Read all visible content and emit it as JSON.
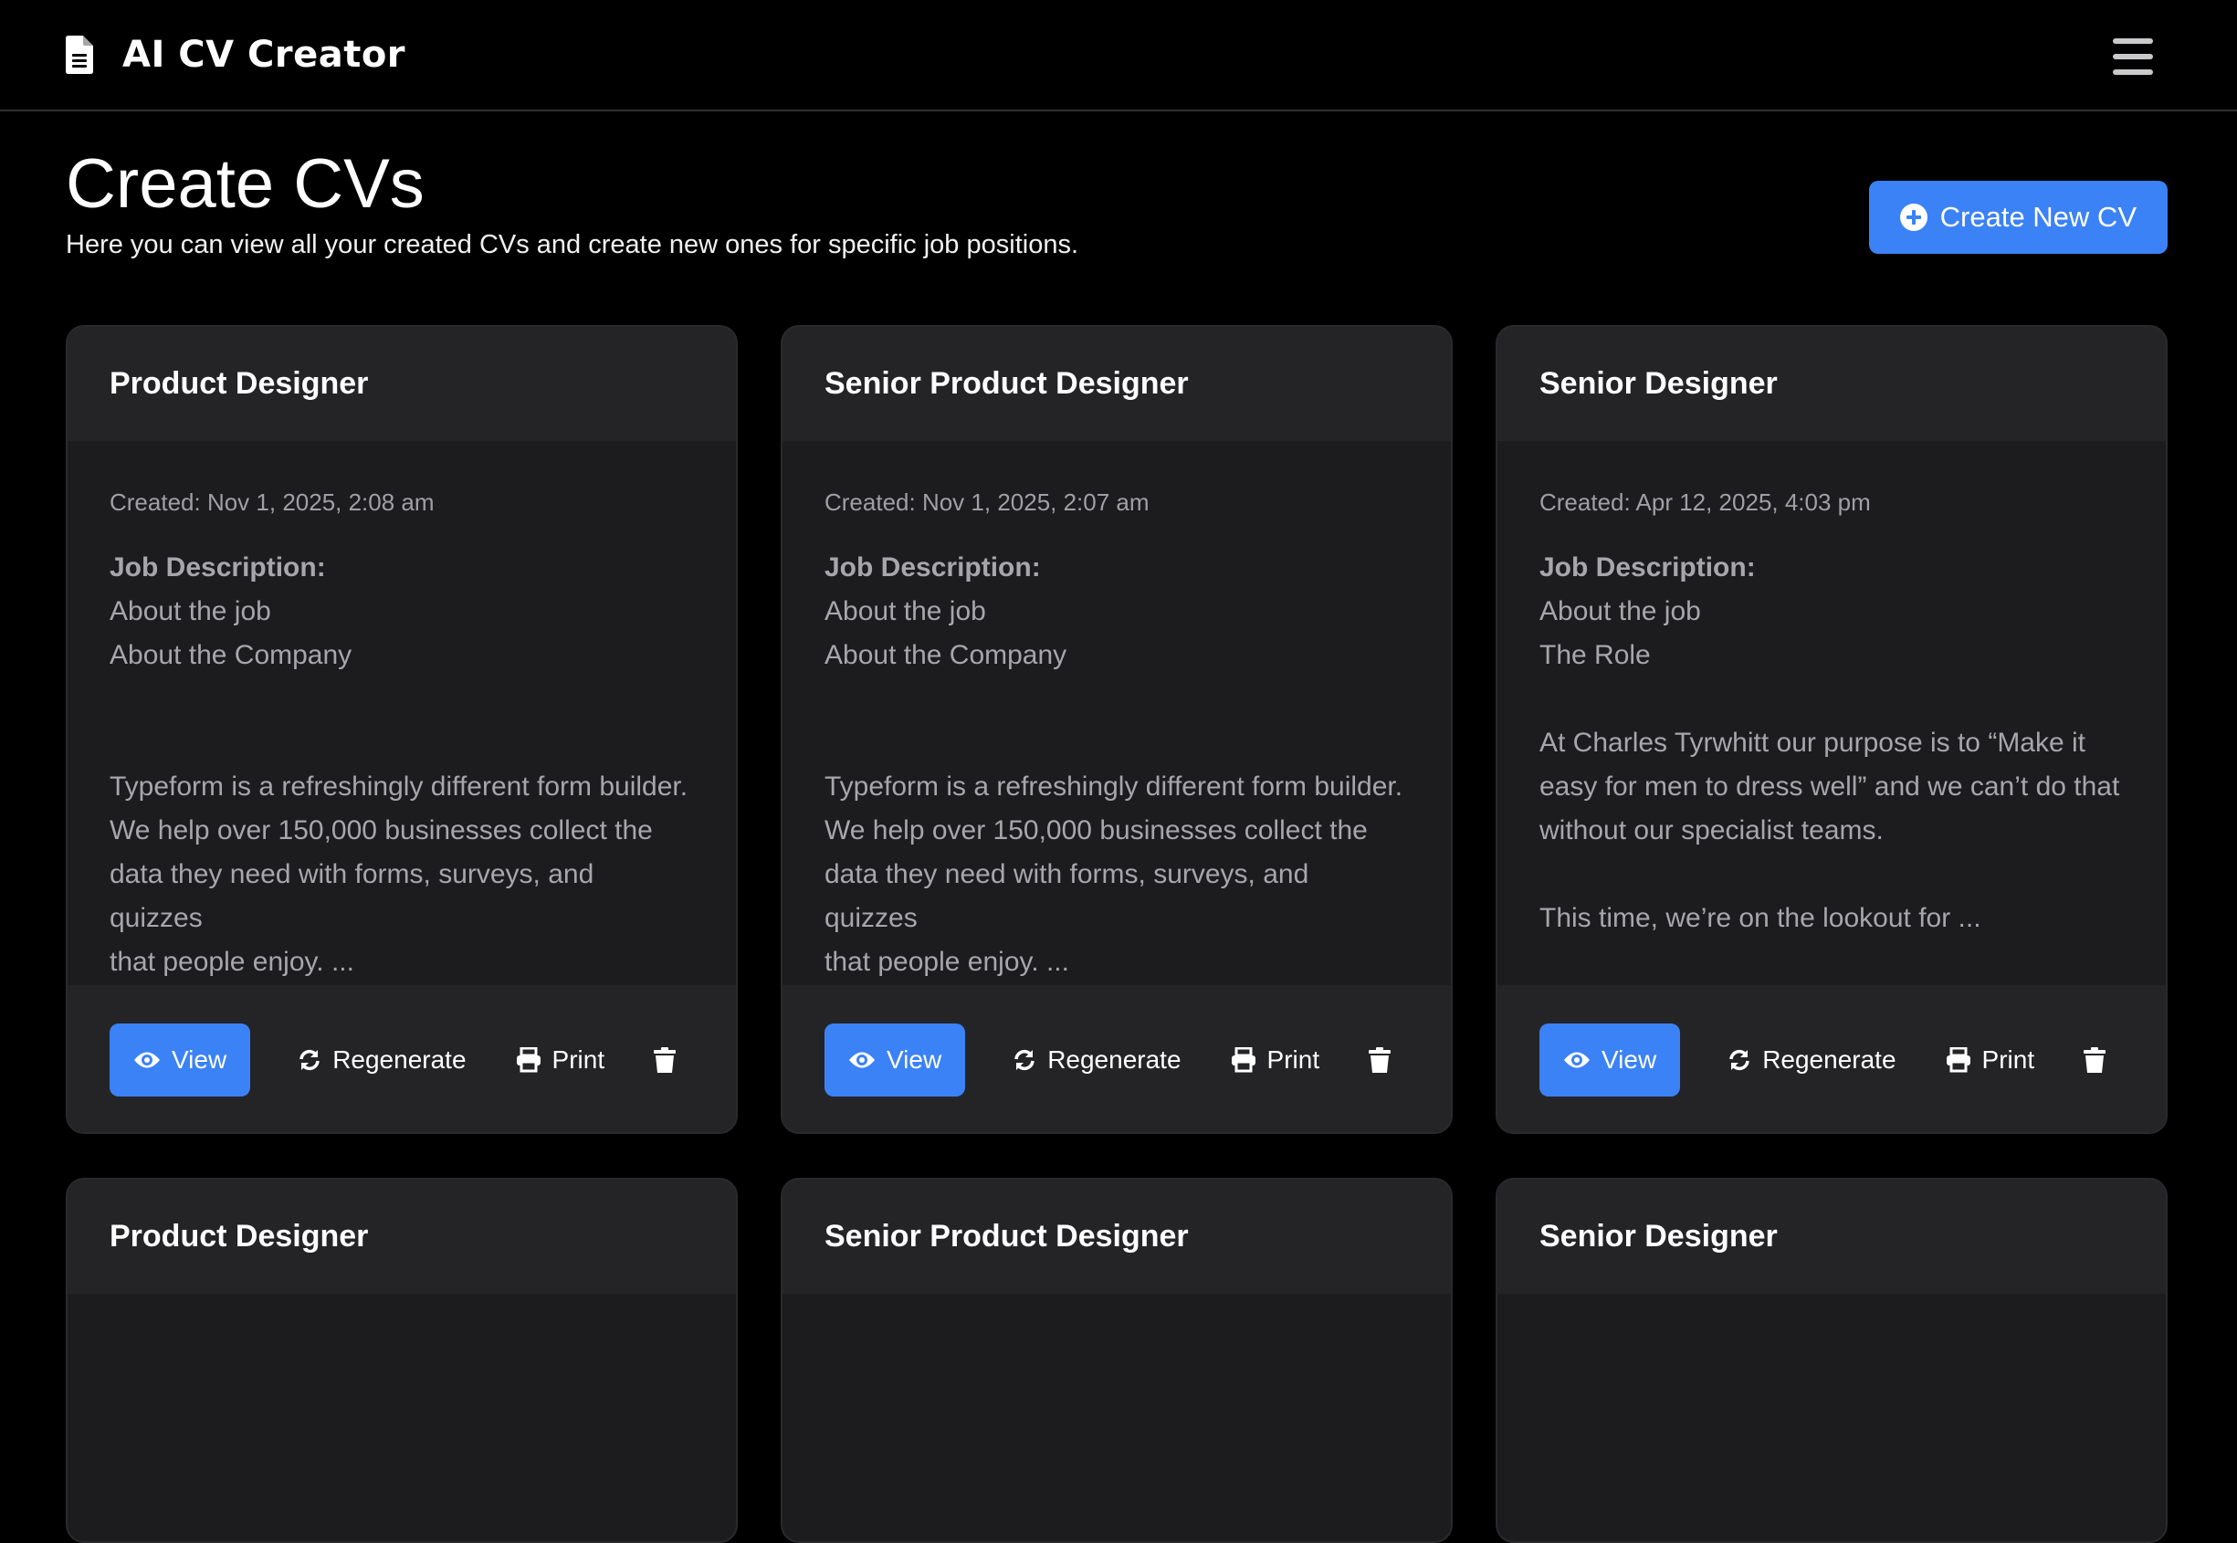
{
  "app": {
    "title": "AI CV Creator",
    "brand_icon": "file-lines-icon",
    "menu_icon": "hamburger-menu-icon"
  },
  "page": {
    "title": "Create CVs",
    "subtitle": "Here you can view all your created CVs and create new ones for specific job positions.",
    "create_button": "Create New CV",
    "create_icon": "plus-circle-icon"
  },
  "colors": {
    "accent": "#3b82f6",
    "background": "#000000",
    "card_body": "#1c1c1f",
    "card_header": "#242427"
  },
  "actions": {
    "view": "View",
    "regenerate": "Regenerate",
    "print": "Print",
    "view_icon": "eye-icon",
    "regenerate_icon": "sync-icon",
    "print_icon": "printer-icon",
    "delete_icon": "trash-icon"
  },
  "cards": [
    {
      "title": "Product Designer",
      "created": "Created: Nov 1, 2025, 2:08 am",
      "jd_label": "Job Description:",
      "jd_text": "About the job\nAbout the Company\n\n\nTypeform is a refreshingly different form builder.\nWe help over 150,000 businesses collect the\ndata they need with forms, surveys, and quizzes\nthat people enjoy. ..."
    },
    {
      "title": "Senior Product Designer",
      "created": "Created: Nov 1, 2025, 2:07 am",
      "jd_label": "Job Description:",
      "jd_text": "About the job\nAbout the Company\n\n\nTypeform is a refreshingly different form builder.\nWe help over 150,000 businesses collect the\ndata they need with forms, surveys, and quizzes\nthat people enjoy. ..."
    },
    {
      "title": "Senior Designer",
      "created": "Created: Apr 12, 2025, 4:03 pm",
      "jd_label": "Job Description:",
      "jd_text": "About the job\nThe Role\n\nAt Charles Tyrwhitt our purpose is to “Make it\neasy for men to dress well” and we can’t do that\nwithout our specialist teams.\n\nThis time, we’re on the lookout for ..."
    },
    {
      "title": "Product Designer"
    },
    {
      "title": "Senior Product Designer"
    },
    {
      "title": "Senior Designer"
    }
  ]
}
